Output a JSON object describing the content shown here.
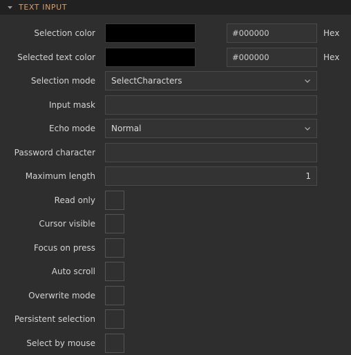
{
  "section": {
    "title": "TEXT INPUT",
    "expanded": true,
    "disclosure_icon": "chevron-down-icon",
    "title_color": "#d9a066",
    "header_bg": "#212121",
    "panel_bg": "#2e2e2e"
  },
  "rows": [
    {
      "label": "Selection color",
      "type": "color",
      "swatch_color": "#000000",
      "hex_value": "#000000",
      "hex_unit": "Hex"
    },
    {
      "label": "Selected text color",
      "type": "color",
      "swatch_color": "#000000",
      "hex_value": "#000000",
      "hex_unit": "Hex"
    },
    {
      "label": "Selection mode",
      "type": "combo",
      "value": "SelectCharacters",
      "icon": "chevron-down-icon"
    },
    {
      "label": "Input mask",
      "type": "text",
      "value": ""
    },
    {
      "label": "Echo mode",
      "type": "combo",
      "value": "Normal",
      "icon": "chevron-down-icon"
    },
    {
      "label": "Password character",
      "type": "text",
      "value": ""
    },
    {
      "label": "Maximum length",
      "type": "number",
      "value": "1"
    },
    {
      "label": "Read only",
      "type": "checkbox",
      "checked": false
    },
    {
      "label": "Cursor visible",
      "type": "checkbox",
      "checked": false
    },
    {
      "label": "Focus on press",
      "type": "checkbox",
      "checked": false
    },
    {
      "label": "Auto scroll",
      "type": "checkbox",
      "checked": false
    },
    {
      "label": "Overwrite mode",
      "type": "checkbox",
      "checked": false
    },
    {
      "label": "Persistent selection",
      "type": "checkbox",
      "checked": false
    },
    {
      "label": "Select by mouse",
      "type": "checkbox",
      "checked": false
    }
  ]
}
